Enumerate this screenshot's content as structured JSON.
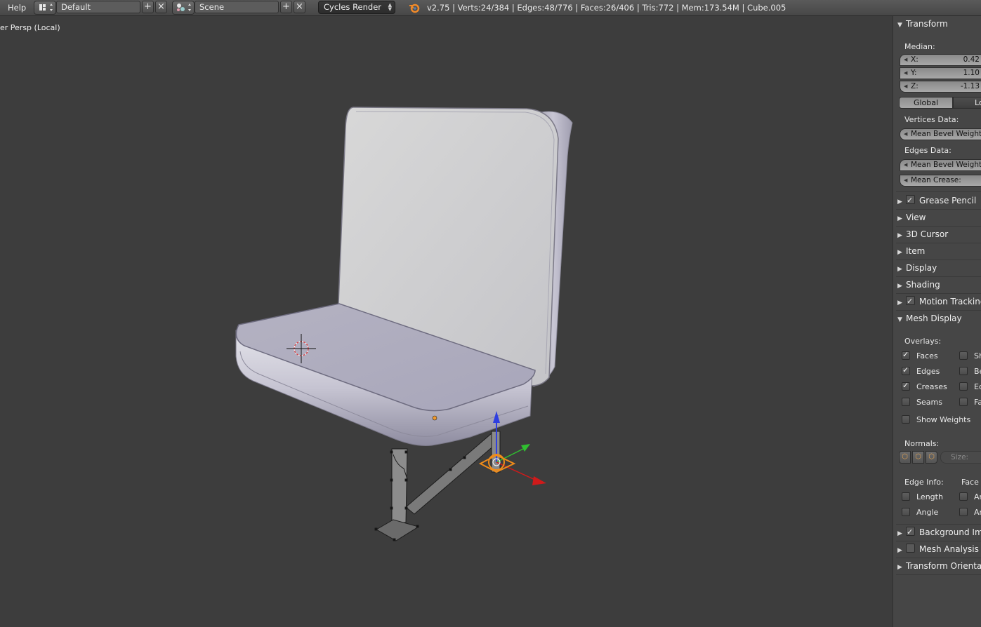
{
  "header": {
    "menu_help": "Help",
    "screen_layout": "Default",
    "scene": "Scene",
    "render_engine": "Cycles Render",
    "stats": "v2.75 | Verts:24/384 | Edges:48/776 | Faces:26/406 | Tris:772 | Mem:173.54M | Cube.005"
  },
  "viewport": {
    "label": "er Persp (Local)"
  },
  "panel": {
    "transform": {
      "title": "Transform",
      "median_label": "Median:",
      "x_label": "X:",
      "x_value": "0.42",
      "y_label": "Y:",
      "y_value": "1.10",
      "z_label": "Z:",
      "z_value": "-1.13",
      "global": "Global",
      "local": "Loc",
      "vertices_data": "Vertices Data:",
      "vert_bevel": "Mean Bevel Weight:",
      "edges_data": "Edges Data:",
      "edge_bevel": "Mean Bevel Weight:",
      "edge_crease": "Mean Crease:"
    },
    "sections": {
      "grease_pencil": "Grease Pencil",
      "view": "View",
      "cursor": "3D Cursor",
      "item": "Item",
      "display": "Display",
      "shading": "Shading",
      "motion_tracking": "Motion Tracking"
    },
    "mesh_display": {
      "title": "Mesh Display",
      "overlays": "Overlays:",
      "faces": "Faces",
      "edges": "Edges",
      "creases": "Creases",
      "seams": "Seams",
      "col2_1": "Sh",
      "col2_2": "Be",
      "col2_3": "Ed",
      "col2_4": "Fa",
      "show_weights": "Show Weights",
      "normals": "Normals:",
      "size": "Size:",
      "edge_info": "Edge Info:",
      "face_info": "Face",
      "length": "Length",
      "angle": "Angle",
      "area_1": "Ar",
      "area_2": "An"
    },
    "bottom": {
      "background_images": "Background Images",
      "mesh_analysis": "Mesh Analysis",
      "transform_orientations": "Transform Orientations"
    }
  }
}
